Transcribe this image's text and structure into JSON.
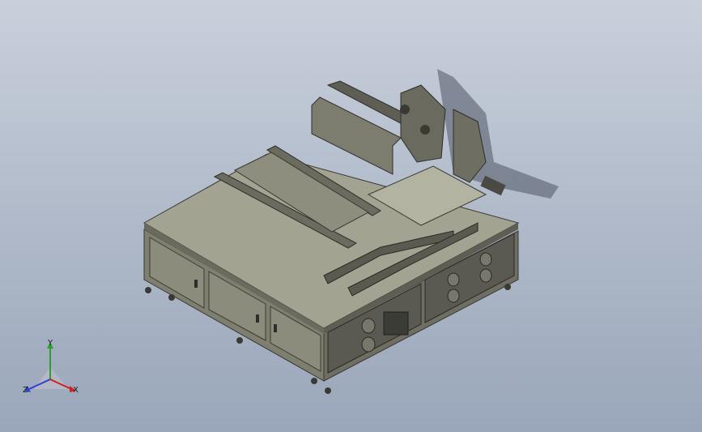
{
  "viewport": {
    "background_top": "#c9d0dc",
    "background_bottom": "#9aa6ba"
  },
  "model": {
    "body_color": "#8a8a7a",
    "top_color": "#a3a392",
    "dark_color": "#4a4a44",
    "shadow_color": "#5c6470"
  },
  "triad": {
    "y_label": "Y",
    "z_label": "Z",
    "x_label": "X",
    "y_color": "#2e9e2e",
    "z_color": "#2f3fd0",
    "x_color": "#d02020"
  }
}
